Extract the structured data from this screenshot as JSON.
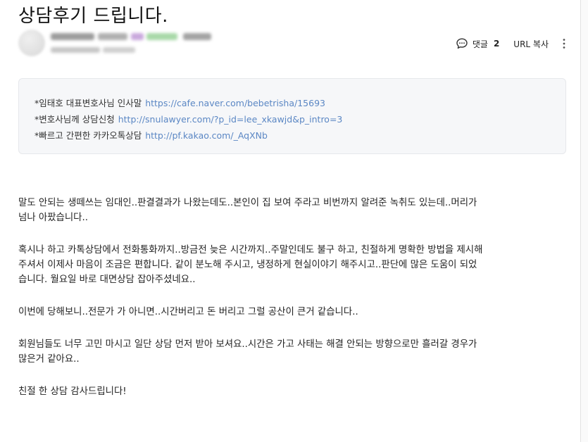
{
  "post": {
    "title": "상담후기 드립니다."
  },
  "actions": {
    "comment_label": "댓글",
    "comment_count": "2",
    "url_copy_label": "URL 복사"
  },
  "info_box": {
    "lines": [
      {
        "label": "*임태호 대표변호사님 인사말",
        "link": "https://cafe.naver.com/bebetrisha/15693"
      },
      {
        "label": "*변호사님께 상담신청",
        "link": "http://snulawyer.com/?p_id=lee_xkawjd&p_intro=3"
      },
      {
        "label": "*빠르고 간편한 카카오톡상담",
        "link": "http://pf.kakao.com/_AqXNb"
      }
    ]
  },
  "body": {
    "paragraphs": [
      {
        "lines": [
          "말도 안되는 생떼쓰는 임대인..판결결과가 나왔는데도..본인이 집 보여 주라고 비번까지 알려준 녹취도 있는데..머리가",
          "넘나 아팠습니다.."
        ]
      },
      {
        "lines": [
          "혹시나 하고 카톡상담에서 전화통화까지..방금전 늦은 시간까지..주말인데도 불구 하고, 친절하게 명확한 방법을 제시해",
          "주셔서 이제사 마음이 조금은 편합니다.  같이 분노해 주시고, 냉정하게 현실이야기 해주시고..판단에 많은 도움이 되었",
          "습니다. 월요일 바로 대면상담  잡아주셨네요.."
        ]
      },
      {
        "lines": [
          "이번에 당해보니..전문가 가 아니면..시간버리고 돈 버리고 그럴 공산이 큰거 같습니다.."
        ]
      },
      {
        "lines": [
          "회원님들도 너무 고민 마시고 일단 상담 먼저 받아 보셔요..시간은 가고 사태는 해결 안되는 방향으로만 흘러갈 경우가",
          "많은거 같아요.."
        ]
      },
      {
        "lines": [
          "친절 한 상담 감사드립니다!"
        ]
      }
    ]
  },
  "icons": {
    "comment": "speech-bubble-icon",
    "more": "vertical-dots-icon"
  },
  "colors": {
    "link": "#5b87c4",
    "info_box_bg": "#f6f7f9"
  }
}
